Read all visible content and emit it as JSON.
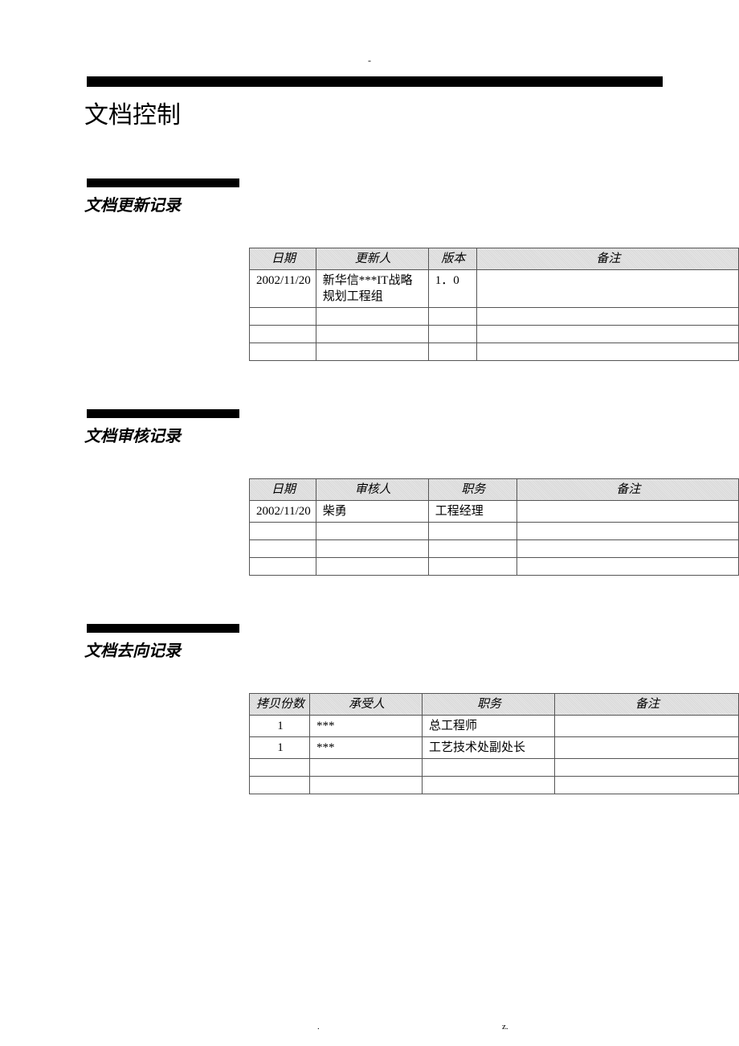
{
  "header_mark": "-",
  "main_title": "文档控制",
  "sections": {
    "update": {
      "title": "文档更新记录",
      "headers": [
        "日期",
        "更新人",
        "版本",
        "备注"
      ],
      "rows": [
        {
          "c0": "2002/11/20",
          "c1": "新华信***IT战略规划工程组",
          "c2": "1．0",
          "c3": ""
        },
        {
          "c0": "",
          "c1": "",
          "c2": "",
          "c3": ""
        },
        {
          "c0": "",
          "c1": "",
          "c2": "",
          "c3": ""
        },
        {
          "c0": "",
          "c1": "",
          "c2": "",
          "c3": ""
        }
      ]
    },
    "review": {
      "title": "文档审核记录",
      "headers": [
        "日期",
        "审核人",
        "职务",
        "备注"
      ],
      "rows": [
        {
          "c0": "2002/11/20",
          "c1": "柴勇",
          "c2": "工程经理",
          "c3": ""
        },
        {
          "c0": "",
          "c1": "",
          "c2": "",
          "c3": ""
        },
        {
          "c0": "",
          "c1": "",
          "c2": "",
          "c3": ""
        },
        {
          "c0": "",
          "c1": "",
          "c2": "",
          "c3": ""
        }
      ]
    },
    "distribute": {
      "title": "文档去向记录",
      "headers": [
        "拷贝份数",
        "承受人",
        "职务",
        "备注"
      ],
      "rows": [
        {
          "c0": "1",
          "c1": "***",
          "c2": "总工程师",
          "c3": ""
        },
        {
          "c0": "1",
          "c1": "***",
          "c2": "工艺技术处副处长",
          "c3": ""
        },
        {
          "c0": "",
          "c1": "",
          "c2": "",
          "c3": ""
        },
        {
          "c0": "",
          "c1": "",
          "c2": "",
          "c3": ""
        }
      ]
    }
  },
  "footer": {
    "left": ".",
    "right": "z."
  }
}
